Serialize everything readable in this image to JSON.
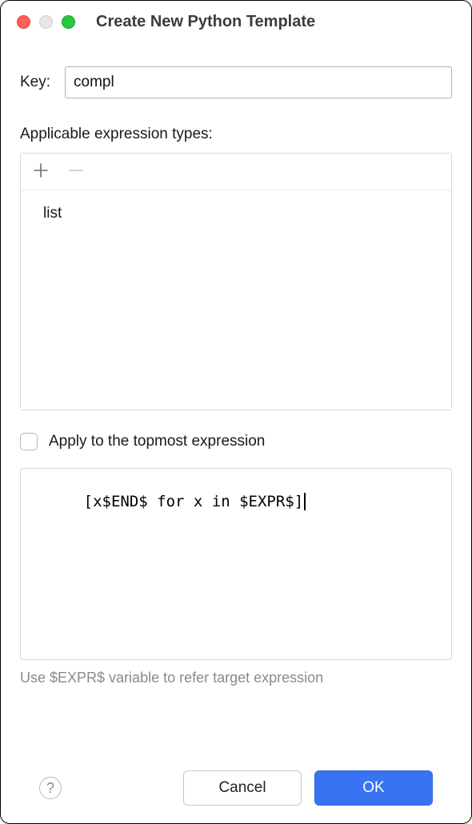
{
  "window": {
    "title": "Create New Python Template"
  },
  "key": {
    "label": "Key:",
    "value": "compl"
  },
  "types": {
    "label": "Applicable expression types:",
    "items": [
      "list"
    ]
  },
  "apply_topmost": {
    "label": "Apply to the topmost expression",
    "checked": false
  },
  "template": {
    "text": "[x$END$ for x in $EXPR$]"
  },
  "hint": "Use $EXPR$ variable to refer target expression",
  "buttons": {
    "cancel": "Cancel",
    "ok": "OK"
  }
}
